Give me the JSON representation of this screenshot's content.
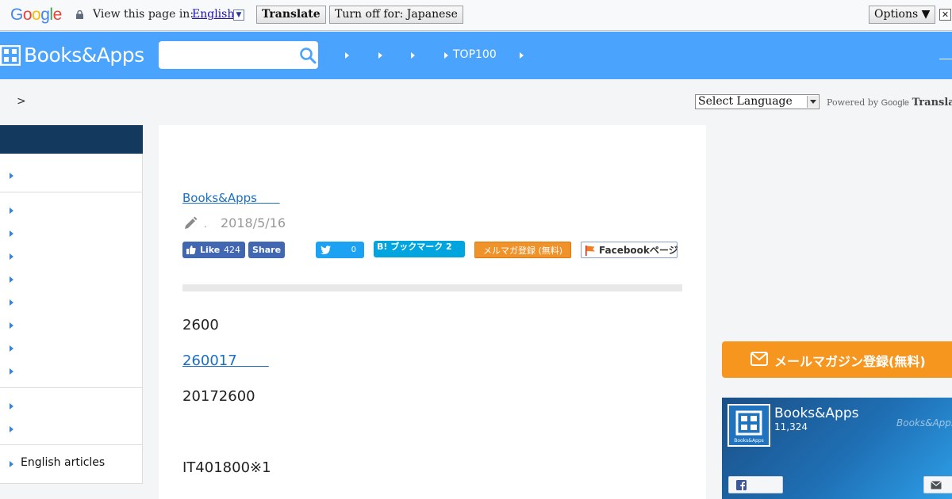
{
  "translate_bar": {
    "logo": "Google",
    "prompt": "View this page in:",
    "language": "English",
    "translate_label": "Translate",
    "turn_off_label": "Turn off for: Japanese",
    "options_label": "Options ▼",
    "close_label": "✕"
  },
  "header": {
    "logo": "Books&Apps",
    "search": {
      "value": "",
      "placeholder": ""
    },
    "nav_top100": "TOP100"
  },
  "breadcrumb": {
    "separator": ">"
  },
  "google_widget": {
    "select_label": "Select Language",
    "powered_by": "Powered by",
    "google": "Google",
    "translate": "Translate"
  },
  "sidebar": {
    "english_articles": "English articles"
  },
  "article": {
    "author_link": "Books&Apps      ",
    "dot": ".",
    "date": "2018/5/16",
    "share": {
      "fb_like": "Like",
      "fb_like_count": "424",
      "fb_share": "Share",
      "tweet_count": "0",
      "hatena": "B! ブックマーク 2",
      "mail": "メルマガ登録 (無料)",
      "facebook_page": "Facebookページ"
    },
    "paragraphs": [
      {
        "text": "2600",
        "link": false
      },
      {
        "text": "260017       ",
        "link": true
      },
      {
        "text": "20172600",
        "link": false
      },
      {
        "text": "IT401800※1",
        "link": false
      }
    ]
  },
  "right_column": {
    "mail_magazine": "メールマガジン登録(無料)",
    "fb_page_name": "Books&Apps",
    "fb_page_likes": "11,324",
    "fb_watermark": "Books&Apps"
  },
  "colors": {
    "header_blue": "#4aa3fd",
    "sidebar_navy": "#133a5e",
    "mail_orange": "#f6961e",
    "link_blue": "#1a6fc4"
  }
}
